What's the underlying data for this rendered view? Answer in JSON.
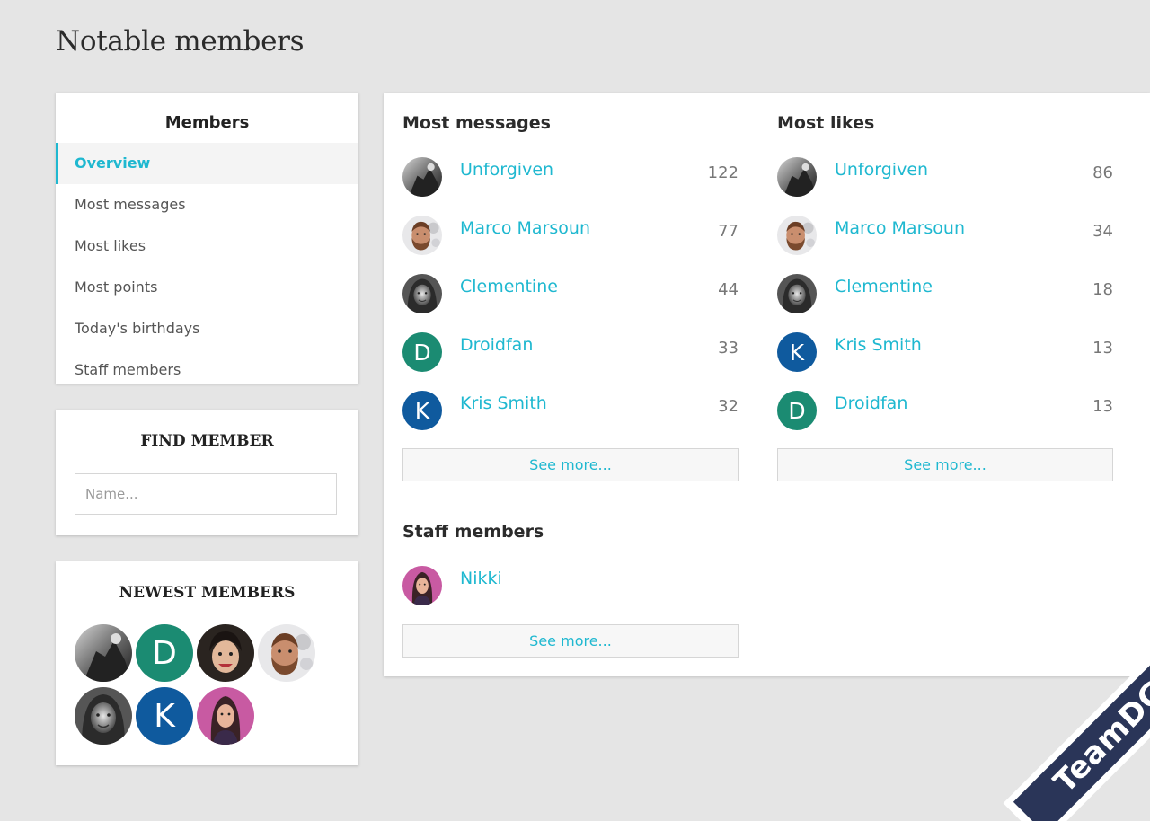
{
  "page": {
    "title": "Notable members"
  },
  "sidebar": {
    "members_nav": {
      "title": "Members",
      "items": [
        {
          "label": "Overview",
          "active": true
        },
        {
          "label": "Most messages"
        },
        {
          "label": "Most likes"
        },
        {
          "label": "Most points"
        },
        {
          "label": "Today's birthdays"
        },
        {
          "label": "Staff members"
        }
      ]
    },
    "find_member": {
      "title": "FIND MEMBER",
      "placeholder": "Name..."
    },
    "newest_members": {
      "title": "NEWEST MEMBERS",
      "avatars": [
        {
          "type": "photo",
          "icon": "dark-photo-avatar"
        },
        {
          "type": "letter",
          "letter": "D",
          "color": "#1b8b72"
        },
        {
          "type": "photo",
          "icon": "smiling-woman-avatar"
        },
        {
          "type": "photo",
          "icon": "bearded-man-avatar"
        },
        {
          "type": "photo",
          "icon": "woman-bw-avatar"
        },
        {
          "type": "letter",
          "letter": "K",
          "color": "#0f5a9e"
        },
        {
          "type": "photo",
          "icon": "illustrated-woman-avatar"
        }
      ]
    }
  },
  "main": {
    "most_messages": {
      "title": "Most messages",
      "members": [
        {
          "name": "Unforgiven",
          "count": "122",
          "avatar": "dark-photo-avatar"
        },
        {
          "name": "Marco Marsoun",
          "count": "77",
          "avatar": "bearded-man-avatar"
        },
        {
          "name": "Clementine",
          "count": "44",
          "avatar": "woman-bw-avatar"
        },
        {
          "name": "Droidfan",
          "count": "33",
          "avatar": "letter",
          "letter": "D",
          "color": "#1b8b72"
        },
        {
          "name": "Kris Smith",
          "count": "32",
          "avatar": "letter",
          "letter": "K",
          "color": "#0f5a9e"
        }
      ],
      "see_more": "See more..."
    },
    "most_likes": {
      "title": "Most likes",
      "members": [
        {
          "name": "Unforgiven",
          "count": "86",
          "avatar": "dark-photo-avatar"
        },
        {
          "name": "Marco Marsoun",
          "count": "34",
          "avatar": "bearded-man-avatar"
        },
        {
          "name": "Clementine",
          "count": "18",
          "avatar": "woman-bw-avatar"
        },
        {
          "name": "Kris Smith",
          "count": "13",
          "avatar": "letter",
          "letter": "K",
          "color": "#0f5a9e"
        },
        {
          "name": "Droidfan",
          "count": "13",
          "avatar": "letter",
          "letter": "D",
          "color": "#1b8b72"
        }
      ],
      "see_more": "See more..."
    },
    "staff_members": {
      "title": "Staff members",
      "members": [
        {
          "name": "Nikki",
          "avatar": "illustrated-woman-avatar"
        }
      ],
      "see_more": "See more..."
    }
  },
  "watermark": {
    "text": "TeamDGT.org"
  },
  "colors": {
    "accent": "#1fb8d0",
    "background": "#e5e5e5",
    "watermark_bg": "#2a3558"
  }
}
